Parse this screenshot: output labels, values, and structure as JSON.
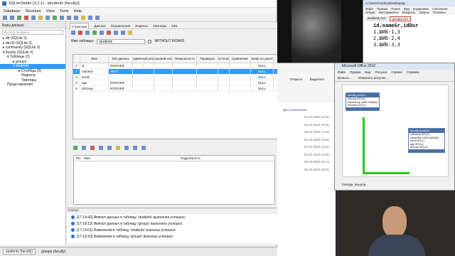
{
  "app": {
    "title": "SQLiteStudio (3.2.1) - [students (faculty)]",
    "menu": [
      "Database",
      "Structure",
      "View",
      "Tools",
      "Help"
    ]
  },
  "db_panel": {
    "header": "Базы данных",
    "filter_placeholder": "Фильтр по имени",
    "tree": [
      "db (SQLite 3)",
      "db-02 (SQLite 3)",
      "community (SQLite 3)",
      "faculty (SQLite 3)",
      "Таблицы (2)",
      "groups",
      "students",
      "Столбцы (5)",
      "Индексы",
      "Триггеры",
      "Представления"
    ]
  },
  "editor": {
    "tabs": [
      "Структура",
      "Данные",
      "Ограничения",
      "Индексы",
      "Триггеры",
      "DDL"
    ],
    "table_name_label": "Имя таблицы:",
    "table_name": "students",
    "without_rowid": "WITHOUT ROWID",
    "columns": [
      "",
      "Имя",
      "Тип данных",
      "Первичный ключ",
      "Внешний ключ",
      "Уникальность",
      "Проверка",
      "Не NULL",
      "Сравнение",
      "чение по умолч"
    ],
    "rows": [
      [
        "1",
        "id",
        "INTEGER",
        "?",
        "",
        "",
        "",
        "",
        "",
        "NULL"
      ],
      [
        "2",
        "nameGr",
        "TEXT",
        "",
        "",
        "",
        "",
        "",
        "",
        "NULL"
      ],
      [
        "3",
        "sexSt",
        "",
        "",
        "",
        "",
        "",
        "",
        "",
        "NULL"
      ],
      [
        "4",
        "age",
        "INTEGER",
        "",
        "",
        "",
        "",
        "",
        "",
        "NULL"
      ],
      [
        "5",
        "idGroup",
        "INTEGER",
        "",
        "",
        "",
        "",
        "",
        "",
        "NULL"
      ]
    ],
    "lower_headers": [
      "Тип",
      "Имя",
      "Подробности"
    ]
  },
  "status": {
    "header": "Статус:",
    "lines": [
      "[17:14:42] Импорт данных в таблицу 'students' выполнен успешно.",
      "[17:18:12] Импорт данных в таблицу 'groups' выполнен успешно.",
      "[17:19:01] Изменения в таблицу 'students' внесены успешно.",
      "[17:19:33] Изменения в таблицу 'groups' внесены успешно."
    ]
  },
  "taskbar": [
    "students (faculty)",
    "groups (faculty)"
  ],
  "notepad": {
    "path": "C:\\Users\\Andrey\\Desktop\\Д...",
    "menu": [
      "Файл",
      "Правка",
      "Поиск",
      "Вид",
      "Кодировки",
      "Синтаксис",
      "Опции",
      "Инструменты",
      "Макросы",
      "Запуск",
      "Плагины"
    ],
    "tabs": [
      "students.csv",
      "groups.csv"
    ],
    "lines": [
      "id,nameGr,idDur",
      "1,ШИБ-1,3",
      "2,ШИБ-2,4",
      "3,ШИБ-3,3"
    ]
  },
  "explorer": {
    "date_header": "Дата изменения",
    "open_label": "Открыть",
    "select_label": "Выделить",
    "dates": [
      "01.04.2020 13:01",
      "01.04.2020 13:01",
      "02.04.2020 17:00",
      "01.04.2020 13:01",
      "01.04.2020 13:01",
      "01.04.2020 13:01",
      "02.04.2020 16:14",
      "01.04.2020 13:01"
    ]
  },
  "access": {
    "title": "Microsoft Office 2010",
    "menu": [
      "Файл",
      "Правка",
      "Вид",
      "Рисунок",
      "Сервис",
      "Справка"
    ],
    "toolbar": [
      "Вольно...",
      "Изменить рисунок..."
    ],
    "box1": {
      "title": "faculty.groups",
      "fields": [
        "idGroup INT(11)",
        "nameGroup VARCHAR(45)",
        "idCenter INT(11)"
      ]
    },
    "box2": {
      "title": "faculty.students",
      "fields": [
        "idStudent INT(11)",
        "nameStud VARCHAR(45)",
        "sexSt INT(1)",
        "age INT(11)",
        "idGroup INT(11)"
      ]
    },
    "footer": "forenge_key.png"
  }
}
